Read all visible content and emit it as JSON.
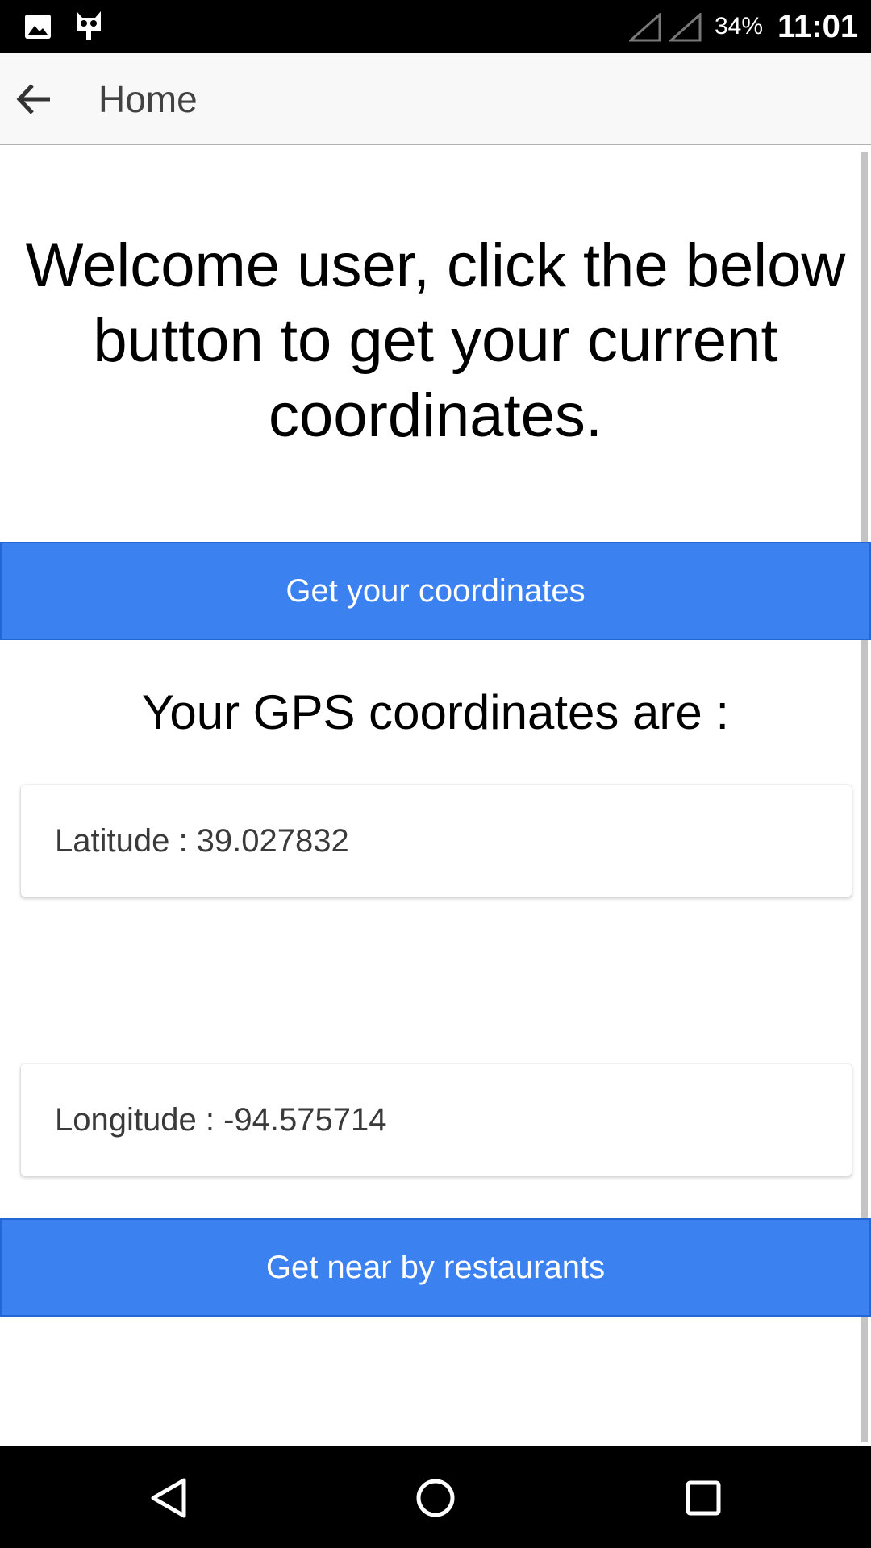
{
  "status_bar": {
    "icons": [
      "gallery-icon",
      "cat-icon",
      "signal-icon",
      "signal-icon"
    ],
    "battery": "34%",
    "time": "11:01"
  },
  "app_bar": {
    "back_icon": "arrow-left-icon",
    "title": "Home"
  },
  "main": {
    "welcome_text": "Welcome user, click the below button to get your current coordinates.",
    "get_coords_button": "Get your coordinates",
    "gps_heading": "Your GPS coordinates are :",
    "latitude_text": "Latitude : 39.027832",
    "longitude_text": "Longitude : -94.575714",
    "restaurants_button": "Get near by restaurants"
  },
  "nav_bar": {
    "icons": [
      "nav-back-icon",
      "nav-home-icon",
      "nav-recents-icon"
    ]
  },
  "colors": {
    "button_blue": "#3b82f0",
    "status_bar": "#000000",
    "app_bar": "#f8f8f8"
  }
}
